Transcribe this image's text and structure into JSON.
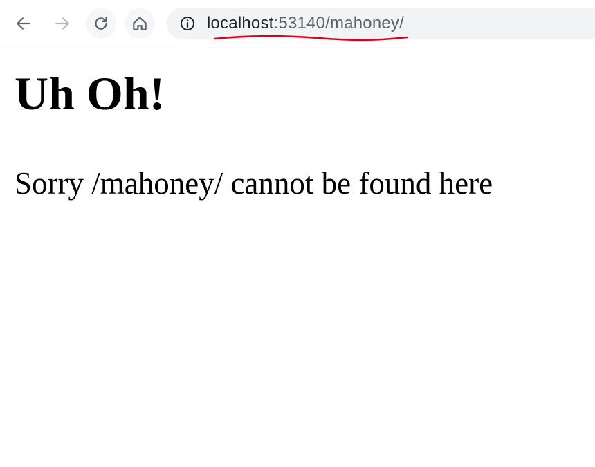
{
  "toolbar": {
    "back_icon": "arrow-left-icon",
    "forward_icon": "arrow-right-icon",
    "reload_icon": "reload-icon",
    "home_icon": "home-icon",
    "site_info_icon": "info-icon"
  },
  "address_bar": {
    "host": "localhost",
    "path": ":53140/mahoney/"
  },
  "annotation": {
    "color": "#e0001b"
  },
  "page": {
    "heading": "Uh Oh!",
    "message": "Sorry /mahoney/ cannot be found here"
  }
}
